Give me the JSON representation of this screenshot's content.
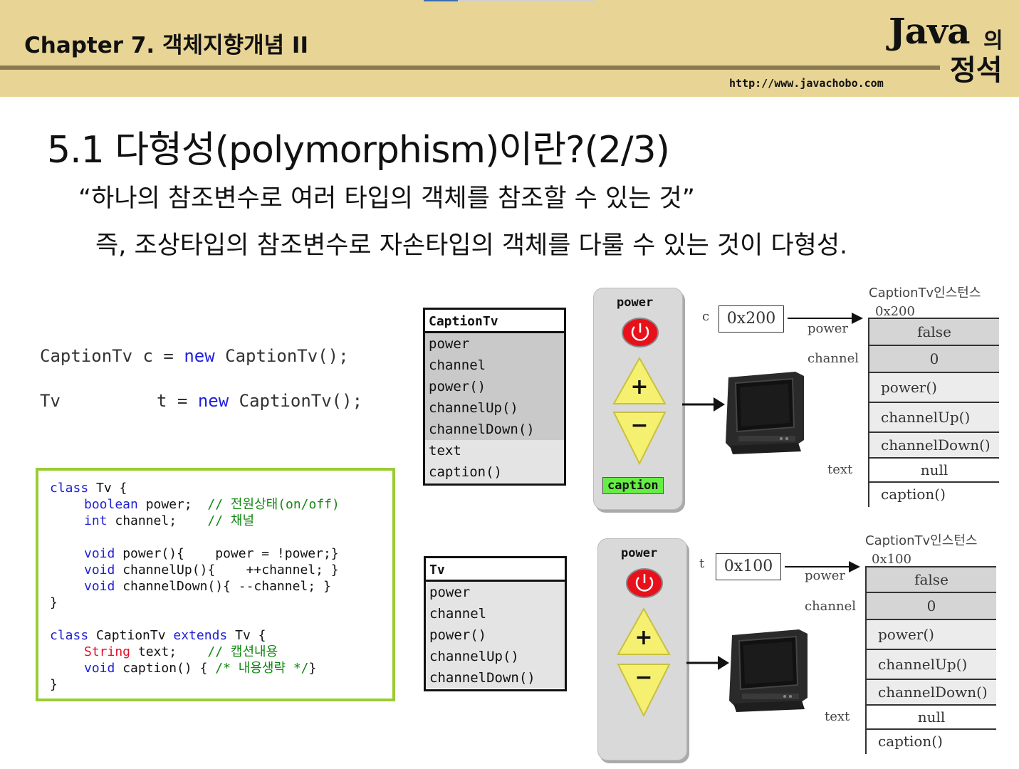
{
  "header": {
    "chapter": "Chapter 7. 객체지향개념 II",
    "logo_java": "Java",
    "logo_ui": "의",
    "logo_jeongseok": "정석",
    "url": "http://www.javachobo.com"
  },
  "slide": {
    "title": "5.1 다형성(polymorphism)이란?(2/3)",
    "quote": "“하나의 참조변수로 여러 타입의 객체를 참조할 수 있는 것”",
    "explanation": "즉, 조상타입의 참조변수로 자손타입의 객체를 다룰 수 있는 것이 다형성."
  },
  "declarations": {
    "line1": {
      "type": "CaptionTv",
      "var": "c",
      "eq": "=",
      "new_kw": "new",
      "ctor": "CaptionTv();"
    },
    "line2": {
      "type": "Tv",
      "var": "t",
      "eq": "=",
      "new_kw": "new",
      "ctor": "CaptionTv();"
    }
  },
  "code": {
    "l1_kw": "class",
    "l1_rest": " Tv {",
    "l2_kw": "boolean",
    "l2_rest": " power;  ",
    "l2_cm": "// 전원상태(on/off)",
    "l3_kw": "int",
    "l3_rest": " channel;    ",
    "l3_cm": "// 채널",
    "l4_kw": "void",
    "l4_rest": " power(){    power = !power;}",
    "l5_kw": "void",
    "l5_rest": " channelUp(){    ++channel; }",
    "l6_kw": "void",
    "l6_rest": " channelDown(){ --channel; }",
    "l7": "}",
    "l8_kw1": "class",
    "l8_mid": " CaptionTv ",
    "l8_kw2": "extends",
    "l8_rest": " Tv {",
    "l9_kw": "String",
    "l9_rest": " text;    ",
    "l9_cm": "// 캡션내용",
    "l10_kw": "void",
    "l10_rest": " caption() { ",
    "l10_cm": "/* 내용생략 */",
    "l10_end": "}",
    "l11": "}"
  },
  "class_boxes": {
    "caption_tv": {
      "name": "CaptionTv",
      "members": [
        "power",
        "channel",
        "power()",
        "channelUp()",
        "channelDown()",
        "text",
        "caption()"
      ]
    },
    "tv": {
      "name": "Tv",
      "members": [
        "power",
        "channel",
        "power()",
        "channelUp()",
        "channelDown()"
      ]
    }
  },
  "remotes": {
    "top": {
      "power_label": "power",
      "plus": "+",
      "minus": "−",
      "caption_label": "caption"
    },
    "bottom": {
      "power_label": "power",
      "plus": "+",
      "minus": "−"
    }
  },
  "instances": {
    "top": {
      "ref_var": "c",
      "ref_value": "0x200",
      "title": "CaptionTv인스턴스",
      "address": "0x200",
      "labels": {
        "power": "power",
        "channel": "channel",
        "text": "text"
      },
      "cells": [
        "false",
        "0",
        "power()",
        "channelUp()",
        "channelDown()",
        "null",
        "caption()"
      ]
    },
    "bottom": {
      "ref_var": "t",
      "ref_value": "0x100",
      "title": "CaptionTv인스턴스",
      "address": "0x100",
      "labels": {
        "power": "power",
        "channel": "channel",
        "text": "text"
      },
      "cells": [
        "false",
        "0",
        "power()",
        "channelUp()",
        "channelDown()",
        "null",
        "caption()"
      ]
    }
  },
  "colors": {
    "header_bg": "#e8d596",
    "code_border": "#99cc33",
    "keyword_blue": "#1f1fd4",
    "keyword_red": "#e0102a",
    "comment_green": "#118811",
    "caption_button": "#66ee44",
    "power_button": "#e8101a",
    "arrow_button": "#f5f070"
  },
  "icons": [
    "power-icon",
    "tv-icon",
    "plus-triangle-icon",
    "minus-triangle-icon"
  ]
}
